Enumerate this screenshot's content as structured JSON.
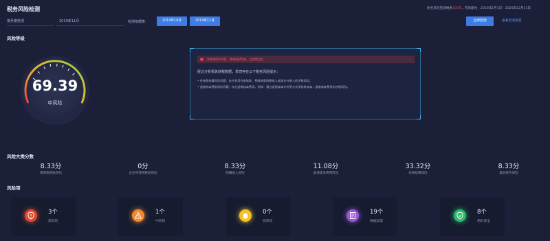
{
  "header": {
    "title": "税务风险检测",
    "info_prefix": "税务风险检测剩余",
    "info_days": "200天",
    "info_suffix": "，有效期为：2020年1月1日 - 2020年12月31日"
  },
  "filters": {
    "period_label": "按月度检测",
    "period_value": "2019年11月",
    "report_label": "检测依据表：",
    "report_chips": [
      "2019年10月",
      "2019年11月"
    ],
    "run_button": "立即检测",
    "history_link": "查看检测报告"
  },
  "risk_level": {
    "section_title": "风险等级",
    "score": "69.39",
    "level": "中风险"
  },
  "alert": {
    "warning": "涉税风险中等，请持续改进，立即检测。",
    "lead": "经过分析相关财税数据，贵司存在以下税务风险提示：",
    "bullets": [
      "往来款核算风险问题：存在利用往来账款、预收账款隐匿收入或部分计收入的涉税风险。",
      "虚增成本费用风险问题：存在虚增成本费用，例如：通过虚假成本计价等方式多结转成本，虚增成本费用的涉税风险。"
    ]
  },
  "scores": {
    "section_title": "风险大类分数",
    "items": [
      {
        "value": "8.33分",
        "label": "增值税税收风险"
      },
      {
        "value": "0分",
        "label": "企业所得税税收风险"
      },
      {
        "value": "8.33分",
        "label": "隐瞒收入风险"
      },
      {
        "value": "11.08分",
        "label": "虚增成本费用风险"
      },
      {
        "value": "33.32分",
        "label": "往来核算风险"
      },
      {
        "value": "8.33分",
        "label": "其他税务风险"
      }
    ]
  },
  "risk_items": {
    "section_title": "风险项",
    "cards": [
      {
        "count": "3个",
        "label": "高风险",
        "color": "#e24a2e",
        "icon": "shield-alert-icon"
      },
      {
        "count": "1个",
        "label": "中风险",
        "color": "#f08a2c",
        "icon": "warning-triangle-icon"
      },
      {
        "count": "0个",
        "label": "低风险",
        "color": "#f0c22c",
        "icon": "bell-icon"
      },
      {
        "count": "19个",
        "label": "数据异常",
        "color": "#9b55d8",
        "icon": "document-icon"
      },
      {
        "count": "8个",
        "label": "相对安全",
        "color": "#2cb86a",
        "icon": "shield-check-icon"
      }
    ]
  },
  "colors": {
    "background": "#1b2038",
    "accent": "#3d7de5",
    "danger": "#e2415a"
  }
}
